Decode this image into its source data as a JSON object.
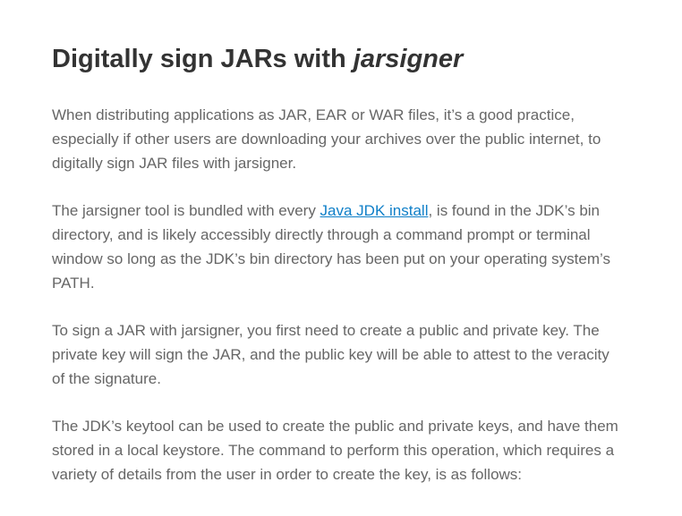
{
  "article": {
    "title_main": "Digitally sign JARs with ",
    "title_emph": "jarsigner",
    "p1": "When distributing applications as JAR, EAR or WAR files, it’s a good practice, especially if other users are downloading your archives over the public internet, to digitally sign JAR files with jarsigner.",
    "p2_before": "The jarsigner tool is bundled with every ",
    "p2_link": "Java JDK install",
    "p2_after": ", is found in the JDK’s bin directory, and is likely accessibly directly through a command prompt or terminal window so long as the JDK’s bin directory has been put on your operating system’s PATH.",
    "p3": "To sign a JAR with jarsigner, you first need to create a public and private key. The private key will sign the JAR, and the public key will be able to attest to the veracity of the signature.",
    "p4": "The JDK’s keytool can be used to create the public and private keys, and have them stored in a local keystore. The command to perform this operation, which requires a variety of details from the user in order to create the key, is as follows:"
  },
  "colors": {
    "heading": "#333333",
    "body_text": "#666666",
    "link": "#0f7fc8",
    "background": "#ffffff"
  }
}
